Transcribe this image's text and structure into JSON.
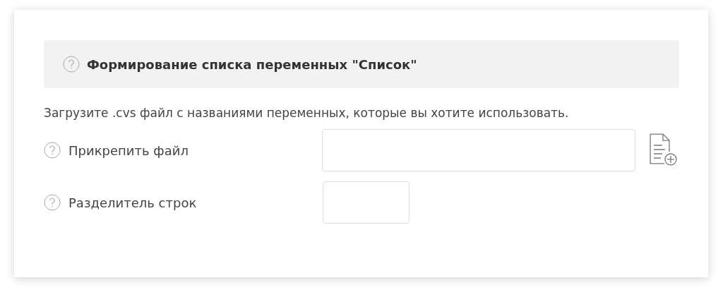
{
  "header": {
    "title": "Формирование списка переменных \"Список\""
  },
  "description": "Загрузите .cvs файл с названиями переменных, которые вы хотите использовать.",
  "fields": [
    {
      "label": "Прикрепить файл",
      "kind": "file"
    },
    {
      "label": "Разделитель строк",
      "kind": "text"
    }
  ]
}
